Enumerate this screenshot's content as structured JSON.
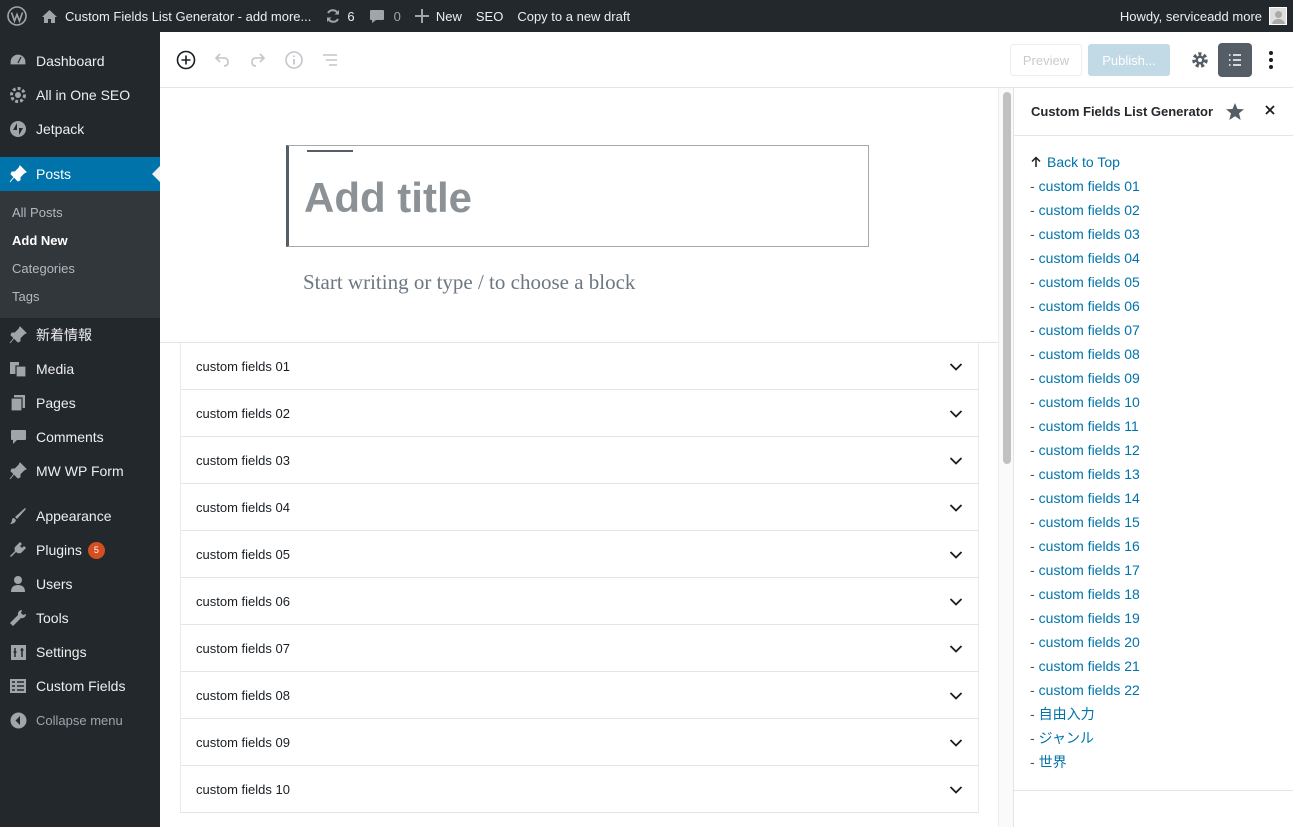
{
  "adminbar": {
    "site_title": "Custom Fields List Generator - add more...",
    "updates_count": "6",
    "comments_count": "0",
    "new_label": "New",
    "seo_label": "SEO",
    "copy_label": "Copy to a new draft",
    "howdy": "Howdy, serviceadd more"
  },
  "sidebar": {
    "items_top": [
      {
        "label": "Dashboard",
        "icon": "dashboard-icon"
      },
      {
        "label": "All in One SEO",
        "icon": "gear-icon"
      },
      {
        "label": "Jetpack",
        "icon": "jetpack-icon"
      }
    ],
    "posts_label": "Posts",
    "submenu": [
      "All Posts",
      "Add New",
      "Categories",
      "Tags"
    ],
    "items_mid": [
      {
        "label": "新着情報",
        "icon": "pin-icon"
      },
      {
        "label": "Media",
        "icon": "media-icon"
      },
      {
        "label": "Pages",
        "icon": "pages-icon"
      },
      {
        "label": "Comments",
        "icon": "comments-icon"
      },
      {
        "label": "MW WP Form",
        "icon": "pin-icon"
      }
    ],
    "items_bottom": [
      {
        "label": "Appearance",
        "icon": "appearance-icon"
      },
      {
        "label": "Plugins",
        "icon": "plugins-icon",
        "badge": "5"
      },
      {
        "label": "Users",
        "icon": "users-icon"
      },
      {
        "label": "Tools",
        "icon": "tools-icon"
      },
      {
        "label": "Settings",
        "icon": "settings-icon"
      },
      {
        "label": "Custom Fields",
        "icon": "custom-fields-icon"
      }
    ],
    "collapse_label": "Collapse menu"
  },
  "header": {
    "preview_label": "Preview",
    "publish_label": "Publish..."
  },
  "editor": {
    "title_placeholder": "Add title",
    "body_placeholder": "Start writing or type / to choose a block",
    "panels": [
      "custom fields 01",
      "custom fields 02",
      "custom fields 03",
      "custom fields 04",
      "custom fields 05",
      "custom fields 06",
      "custom fields 07",
      "custom fields 08",
      "custom fields 09",
      "custom fields 10"
    ]
  },
  "side_panel": {
    "title": "Custom Fields List Generator",
    "back_to_top": "Back to Top",
    "links": [
      "custom fields 01",
      "custom fields 02",
      "custom fields 03",
      "custom fields 04",
      "custom fields 05",
      "custom fields 06",
      "custom fields 07",
      "custom fields 08",
      "custom fields 09",
      "custom fields 10",
      "custom fields 11",
      "custom fields 12",
      "custom fields 13",
      "custom fields 14",
      "custom fields 15",
      "custom fields 16",
      "custom fields 17",
      "custom fields 18",
      "custom fields 19",
      "custom fields 20",
      "custom fields 21",
      "custom fields 22",
      "自由入力",
      "ジャンル",
      "世界"
    ],
    "dash": "-"
  },
  "colors": {
    "adminbar_bg": "#23282d",
    "active_menu": "#0073aa",
    "link": "#0073aa",
    "badge": "#d54e21"
  }
}
